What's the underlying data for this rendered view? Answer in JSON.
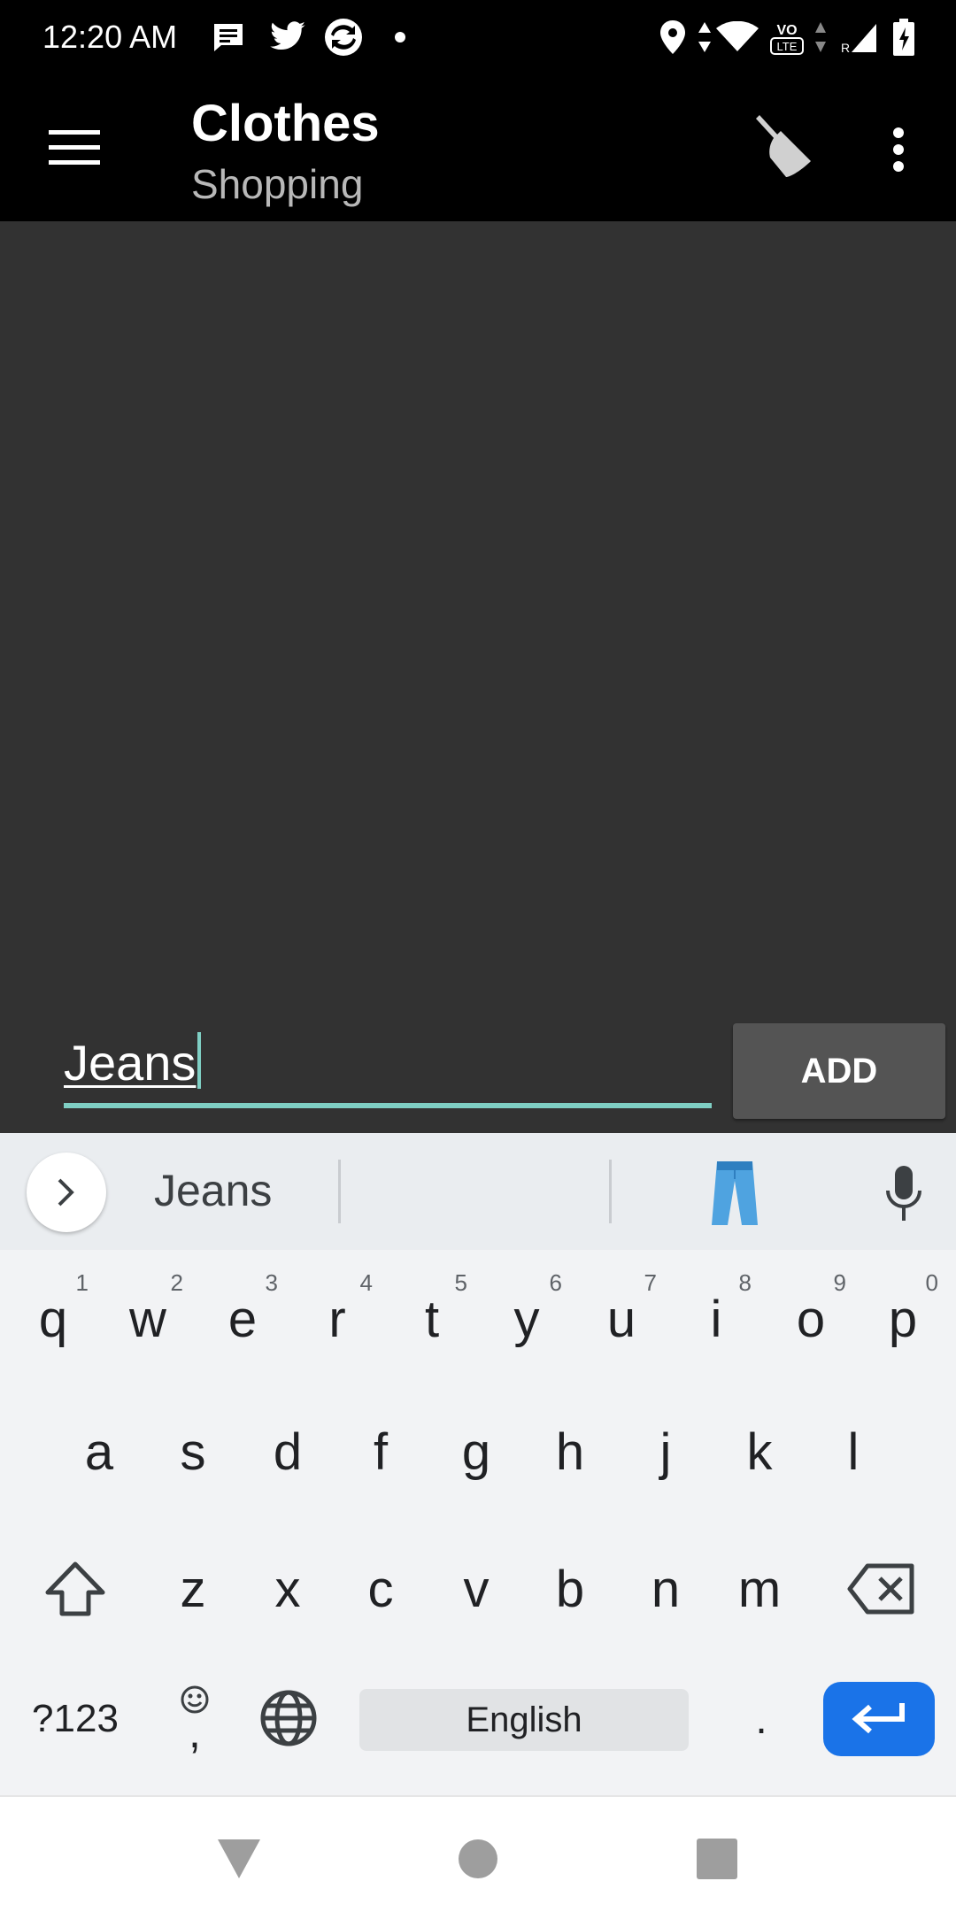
{
  "status_bar": {
    "time": "12:20 AM",
    "icons": [
      "message-icon",
      "twitter-icon",
      "sync-app-icon",
      "notification-dot-icon",
      "location-icon",
      "data-arrows-icon",
      "wifi-icon",
      "volte-icon",
      "signal-icon",
      "battery-icon"
    ]
  },
  "app_bar": {
    "title": "Clothes",
    "subtitle": "Shopping",
    "icons": [
      "hamburger-menu-icon",
      "broom-icon",
      "more-vert-icon"
    ]
  },
  "form": {
    "input_value": "Jeans",
    "add_label": "ADD",
    "accent_color": "#7fcfc4"
  },
  "keyboard": {
    "suggestions": [
      "Jeans"
    ],
    "row1": [
      {
        "key": "q",
        "hint": "1"
      },
      {
        "key": "w",
        "hint": "2"
      },
      {
        "key": "e",
        "hint": "3"
      },
      {
        "key": "r",
        "hint": "4"
      },
      {
        "key": "t",
        "hint": "5"
      },
      {
        "key": "y",
        "hint": "6"
      },
      {
        "key": "u",
        "hint": "7"
      },
      {
        "key": "i",
        "hint": "8"
      },
      {
        "key": "o",
        "hint": "9"
      },
      {
        "key": "p",
        "hint": "0"
      }
    ],
    "row2": [
      "a",
      "s",
      "d",
      "f",
      "g",
      "h",
      "j",
      "k",
      "l"
    ],
    "row3": [
      "z",
      "x",
      "c",
      "v",
      "b",
      "n",
      "m"
    ],
    "symbols_label": "?123",
    "comma_label": ",",
    "space_label": "English",
    "period_label": ".",
    "enter_color": "#1a73e8"
  },
  "nav_bar": {
    "icons": [
      "back-icon",
      "home-icon",
      "recents-icon"
    ]
  }
}
